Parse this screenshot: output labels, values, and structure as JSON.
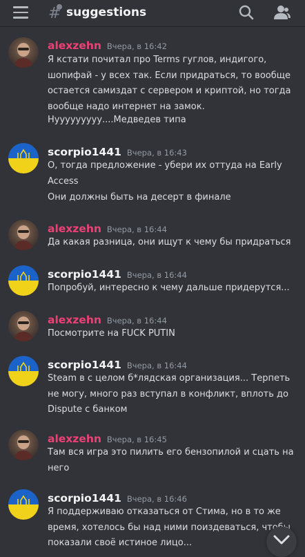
{
  "channel": {
    "name": "suggestions"
  },
  "icons": {
    "menu": "hamburger-menu-icon",
    "channel": "threads-hash-icon",
    "search": "search-icon",
    "members": "members-icon",
    "scroll": "chevron-down-icon"
  },
  "colors": {
    "alex_name": "#ed4176",
    "scorp_name": "#f2f3f5",
    "background": "#313338"
  },
  "messages": [
    {
      "user": "alexzehn",
      "time": "Вчера, в 16:42",
      "lines": [
        "Я кстати почитал про Terms гуглов, индигого,",
        "шопифай - у всех так. Если придраться, то вообще",
        "остается самиздат с сервером и криптой, но тогда",
        "вообще надо интернет на замок."
      ],
      "extra": "Нууууууууу....Медведев типа"
    },
    {
      "user": "scorpio1441",
      "time": "Вчера, в 16:43",
      "lines": [
        "О, тогда предложение - убери их оттуда на Early",
        "Access"
      ],
      "extra": "Они должны быть на десерт в финале"
    },
    {
      "user": "alexzehn",
      "time": "Вчера, в 16:44",
      "lines": [
        "Да какая разница, они ищут к чему бы придраться"
      ]
    },
    {
      "user": "scorpio1441",
      "time": "Вчера, в 16:44",
      "lines": [
        "Попробуй, интересно к чему дальше придерутся..."
      ]
    },
    {
      "user": "alexzehn",
      "time": "Вчера, в 16:44",
      "lines": [
        "Посмотрите на FUCK PUTIN"
      ]
    },
    {
      "user": "scorpio1441",
      "time": "Вчера, в 16:44",
      "lines": [
        "Steam в с целом б*лядская организация... Терпеть",
        "не могу, много раз вступал в конфликт, вплоть до",
        "Dispute с банком"
      ]
    },
    {
      "user": "alexzehn",
      "time": "Вчера, в 16:45",
      "lines": [
        "Там вся игра это пилить его бензопилой и сцать на",
        "него"
      ]
    },
    {
      "user": "scorpio1441",
      "time": "Вчера, в 16:46",
      "lines": [
        "Я поддерживаю отказаться от Стима, но в то же",
        "время, хотелось бы над ними поиздеваться, чтобы",
        "показали своё истиное лицо..."
      ]
    }
  ]
}
